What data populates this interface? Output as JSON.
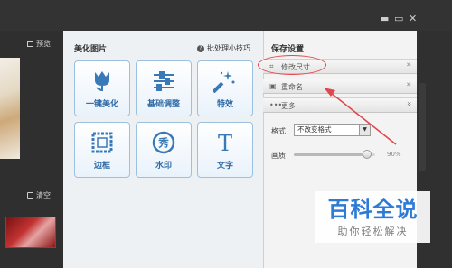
{
  "window": {
    "controls": [
      "▬",
      "▭",
      "—",
      "✕"
    ]
  },
  "left": {
    "preview_label": "预览",
    "clear_label": "清空"
  },
  "beautify": {
    "title": "美化图片",
    "tips_label": "批处理小技巧",
    "tools": [
      {
        "label": "一键美化",
        "icon": "tulip-icon"
      },
      {
        "label": "基础调整",
        "icon": "sliders-icon"
      },
      {
        "label": "特效",
        "icon": "magic-wand-icon"
      },
      {
        "label": "边框",
        "icon": "frame-icon"
      },
      {
        "label": "水印",
        "icon": "watermark-icon"
      },
      {
        "label": "文字",
        "icon": "text-icon"
      }
    ]
  },
  "save_settings": {
    "title": "保存设置",
    "rows": [
      {
        "label": "修改尺寸",
        "chevron": "»"
      },
      {
        "label": "重命名",
        "chevron": "»"
      },
      {
        "label": "更多",
        "chevron": "»"
      }
    ],
    "format_label": "格式",
    "format_value": "不改变格式",
    "quality_label": "画质",
    "quality_value": "90%",
    "quality_fraction": 0.9
  },
  "watermark": {
    "main": "百科全说",
    "sub": "助你轻松解决"
  },
  "colors": {
    "accent": "#2e6aa6",
    "highlight": "#e0474d",
    "watermark_blue": "#2c7bd6"
  }
}
